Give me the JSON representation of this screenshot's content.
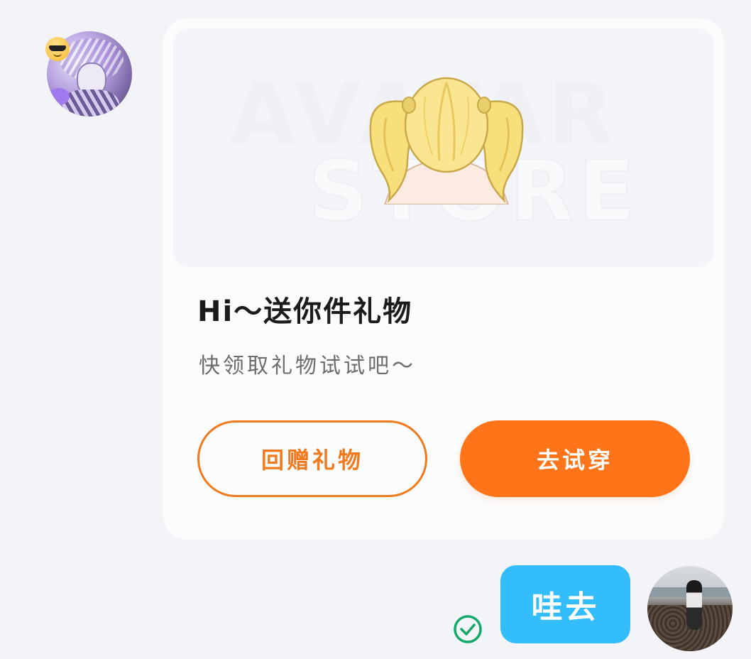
{
  "conversation": {
    "received_card": {
      "banner": {
        "watermark_line1": "AVATAR",
        "watermark_line2": "STORE",
        "item_icon": "pigtail-hair-icon"
      },
      "title": "Hi～送你件礼物",
      "subtitle": "快领取礼物试试吧～",
      "buttons": {
        "return_gift": "回赠礼物",
        "try_on": "去试穿"
      }
    },
    "sent_message": {
      "text": "哇去",
      "status_icon": "check-circle-icon"
    }
  },
  "colors": {
    "page_bg": "#f3f4f7",
    "card_bg": "#fbfcfd",
    "accent_orange": "#ff7418",
    "bubble_blue": "#33bdfd",
    "read_green": "#15a86b"
  }
}
